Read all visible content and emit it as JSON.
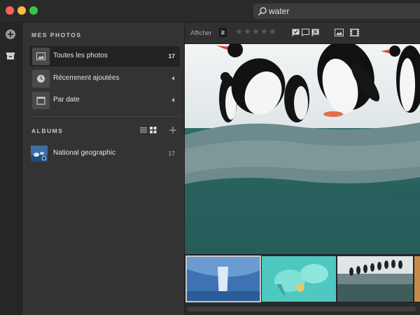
{
  "search": {
    "value": "water",
    "icon": "search-icon"
  },
  "sidebar": {
    "section_photos": "MES PHOTOS",
    "items": [
      {
        "label": "Toutes les photos",
        "count": "17",
        "icon": "photo-icon"
      },
      {
        "label": "Récemment ajoutées",
        "icon": "clock-icon"
      },
      {
        "label": "Par date",
        "icon": "calendar-icon"
      }
    ],
    "section_albums": "ALBUMS",
    "albums": [
      {
        "label": "National geographic",
        "count": "17"
      }
    ]
  },
  "toolbar": {
    "show_label": "Afficher",
    "filter_symbol": "≥",
    "stars": [
      "★",
      "★",
      "★",
      "★",
      "★"
    ]
  },
  "colors": {
    "accent": "#1a1a1a",
    "selection": "#222222"
  }
}
